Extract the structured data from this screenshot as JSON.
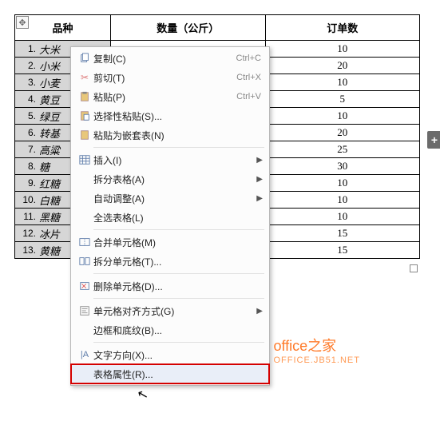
{
  "table": {
    "headers": [
      "品种",
      "数量（公斤）",
      "订单数"
    ],
    "rows": [
      {
        "idx": "1.",
        "name": "大米",
        "qty": "",
        "ord": "10"
      },
      {
        "idx": "2.",
        "name": "小米",
        "qty": "",
        "ord": "20"
      },
      {
        "idx": "3.",
        "name": "小麦",
        "qty": "",
        "ord": "10"
      },
      {
        "idx": "4.",
        "name": "黄豆",
        "qty": "",
        "ord": "5"
      },
      {
        "idx": "5.",
        "name": "绿豆",
        "qty": "",
        "ord": "10"
      },
      {
        "idx": "6.",
        "name": "转基",
        "qty": "",
        "ord": "20"
      },
      {
        "idx": "7.",
        "name": "高粱",
        "qty": "",
        "ord": "25"
      },
      {
        "idx": "8.",
        "name": "糖",
        "qty": "",
        "ord": "30"
      },
      {
        "idx": "9.",
        "name": "红糖",
        "qty": "",
        "ord": "10"
      },
      {
        "idx": "10.",
        "name": "白糖",
        "qty": "",
        "ord": "10"
      },
      {
        "idx": "11.",
        "name": "黑糖",
        "qty": "",
        "ord": "10"
      },
      {
        "idx": "12.",
        "name": "冰片",
        "qty": "",
        "ord": "15"
      },
      {
        "idx": "13.",
        "name": "黄糖",
        "qty": "",
        "ord": "15"
      }
    ]
  },
  "menu": {
    "copy": {
      "label": "复制(C)",
      "shortcut": "Ctrl+C"
    },
    "cut": {
      "label": "剪切(T)",
      "shortcut": "Ctrl+X"
    },
    "paste": {
      "label": "粘贴(P)",
      "shortcut": "Ctrl+V"
    },
    "paste_special": {
      "label": "选择性粘贴(S)..."
    },
    "paste_nested": {
      "label": "粘贴为嵌套表(N)"
    },
    "insert": {
      "label": "插入(I)"
    },
    "split_table": {
      "label": "拆分表格(A)"
    },
    "autofit": {
      "label": "自动调整(A)"
    },
    "select_table": {
      "label": "全选表格(L)"
    },
    "merge_cells": {
      "label": "合并单元格(M)"
    },
    "split_cells": {
      "label": "拆分单元格(T)..."
    },
    "delete_cells": {
      "label": "删除单元格(D)..."
    },
    "cell_align": {
      "label": "单元格对齐方式(G)"
    },
    "borders": {
      "label": "边框和底纹(B)..."
    },
    "text_dir": {
      "label": "文字方向(X)..."
    },
    "table_props": {
      "label": "表格属性(R)..."
    }
  },
  "watermark": {
    "main": "office之家",
    "sub": "OFFICE.JB51.NET"
  },
  "side_plus": "+"
}
